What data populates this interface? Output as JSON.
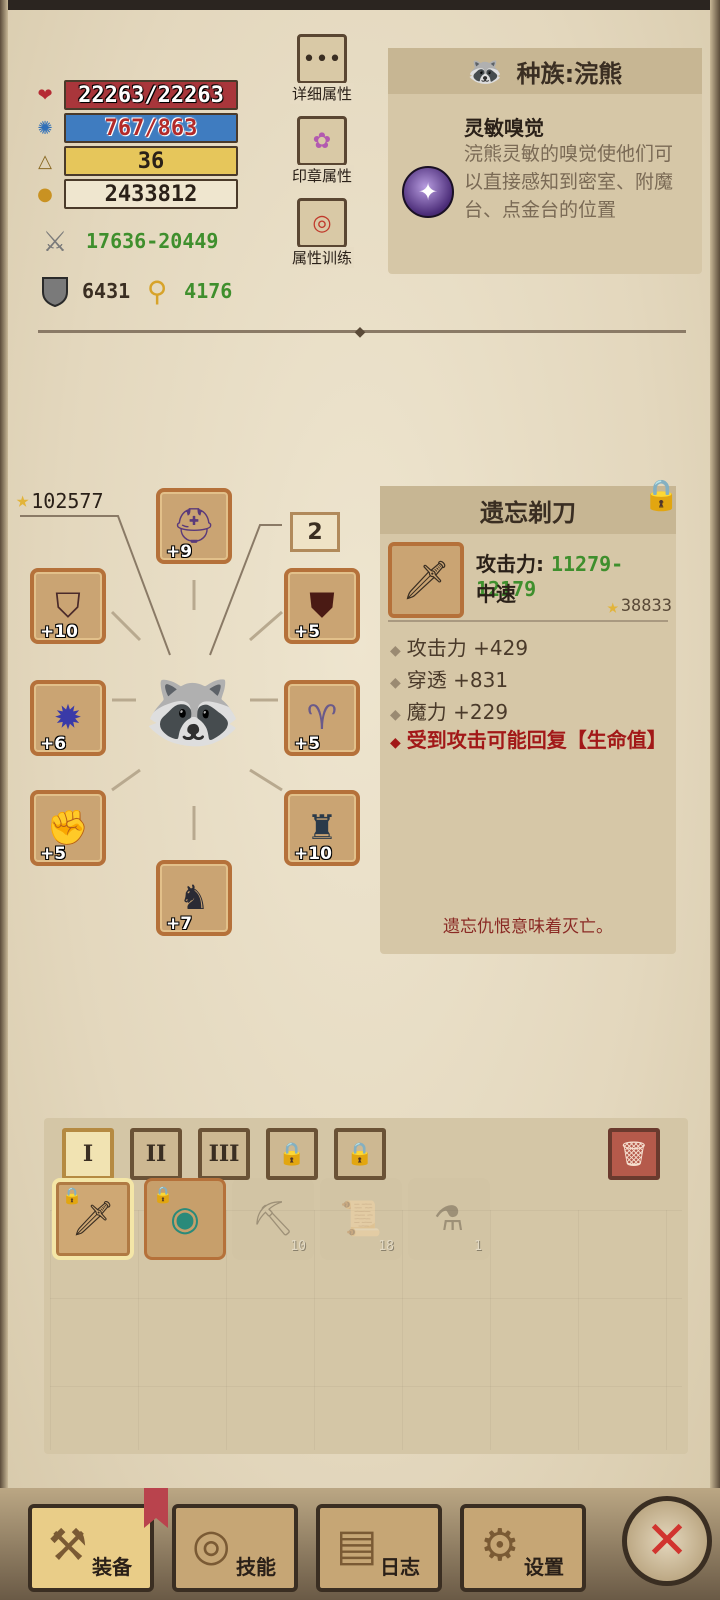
{
  "stats": {
    "hp": "22263/22263",
    "mp": "767/863",
    "level": "36",
    "gold": "2433812",
    "attack_range": "17636-20449",
    "defense": "6431",
    "magic_defense": "4176"
  },
  "side_buttons": {
    "details": "详细属性",
    "seal": "印章属性",
    "training": "属性训练"
  },
  "race": {
    "title": "种族:浣熊",
    "skill_name": "灵敏嗅觉",
    "skill_desc": "浣熊灵敏的嗅觉使他们可以直接感知到密室、附魔台、点金台的位置"
  },
  "equipment": {
    "power": "102577",
    "badge": "2",
    "slots": {
      "helmet": "+9",
      "left_top": "+10",
      "right_top": "+5",
      "left_mid": "+6",
      "right_mid": "+5",
      "left_bottom": "+5",
      "right_bottom": "+10",
      "bottom": "+7"
    }
  },
  "item": {
    "name": "遗忘剃刀",
    "atk_label": "攻击力: ",
    "atk_value": "11279-12179",
    "speed": "中速",
    "score": "38833",
    "affixes": [
      "攻击力 +429",
      "穿透 +831",
      "魔力 +229"
    ],
    "special": "受到攻击可能回复【生命值】",
    "flavor": "遗忘仇恨意味着灭亡。"
  },
  "inventory": {
    "tabs": [
      "I",
      "II",
      "III"
    ],
    "counts": {
      "pickaxe": "10",
      "map": "18",
      "potion": "1"
    }
  },
  "nav": {
    "equip": "装备",
    "skills": "技能",
    "log": "日志",
    "settings": "设置"
  }
}
